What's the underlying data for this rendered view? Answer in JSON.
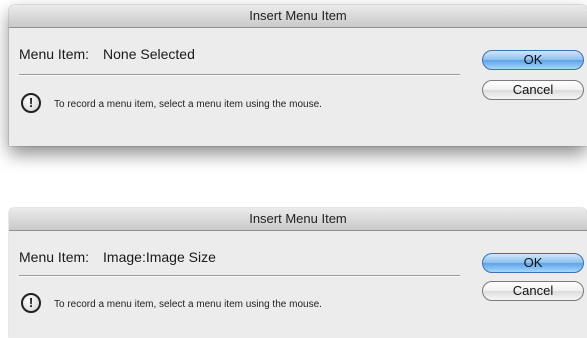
{
  "dialogs": [
    {
      "title": "Insert Menu Item",
      "menu_item_label": "Menu Item:",
      "menu_item_value": "None Selected",
      "hint": "To record a menu item, select a menu item using the mouse.",
      "ok_label": "OK",
      "cancel_label": "Cancel",
      "icon": "exclamation-icon"
    },
    {
      "title": "Insert Menu Item",
      "menu_item_label": "Menu Item:",
      "menu_item_value": "Image:Image Size",
      "hint": "To record a menu item, select a menu item using the mouse.",
      "ok_label": "OK",
      "cancel_label": "Cancel",
      "icon": "exclamation-icon"
    }
  ],
  "colors": {
    "ok_button": "#8fc2f0",
    "dialog_bg": "#ececec"
  }
}
